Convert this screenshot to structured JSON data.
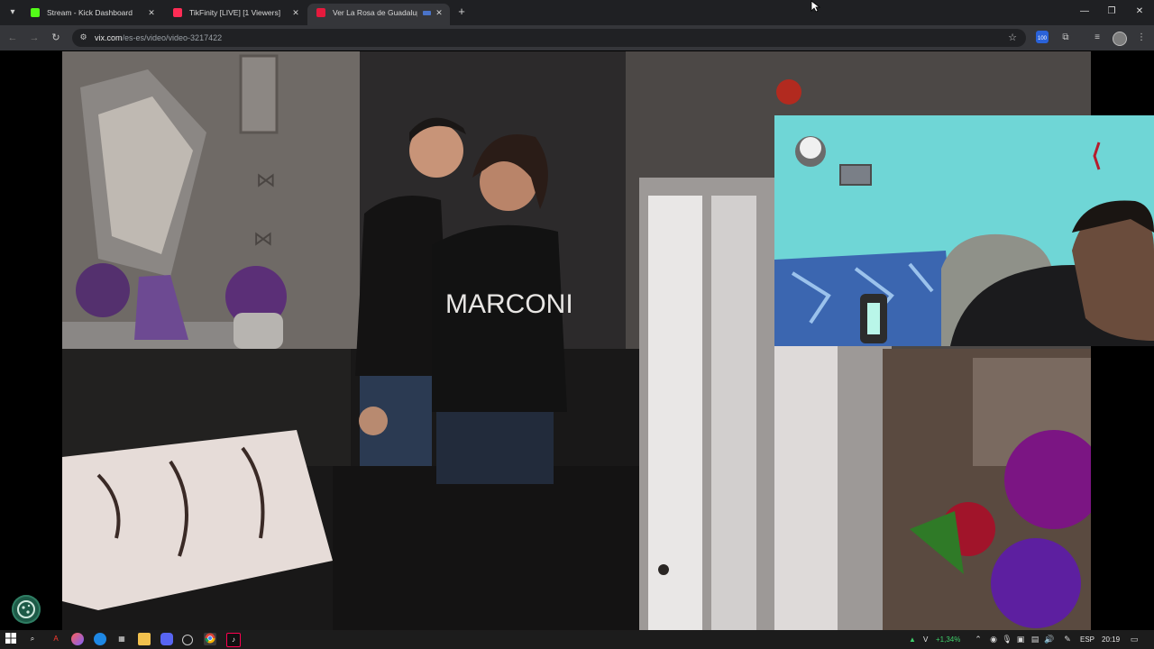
{
  "tabs": [
    {
      "title": "Stream - Kick Dashboard",
      "favicon_color": "#53fc18",
      "active": false
    },
    {
      "title": "TikFinity [LIVE] [1 Viewers]",
      "favicon_color": "#fe2c55",
      "active": false
    },
    {
      "title": "Ver La Rosa de Guadalupe,",
      "favicon_color": "#e51a3d",
      "active": true
    }
  ],
  "address_bar": {
    "host": "vix.com",
    "path": "/es-es/video/video-3217422"
  },
  "extensions": {
    "badge_text": "100"
  },
  "video": {
    "shirt_text": "MARCONI"
  },
  "taskbar": {
    "weather_change": "+1,34%",
    "weather_letter": "V",
    "language": "ESP",
    "clock": "20:19"
  },
  "colors": {
    "tab_bar": "#1f2023",
    "toolbar": "#35363a",
    "omnibox": "#202124",
    "taskbar": "#1c1c1c",
    "stock_up": "#3fcf6a"
  },
  "icons": {
    "window_controls": [
      "minimize-icon",
      "restore-icon",
      "close-icon"
    ],
    "nav": [
      "back-icon",
      "forward-icon",
      "reload-icon"
    ]
  }
}
